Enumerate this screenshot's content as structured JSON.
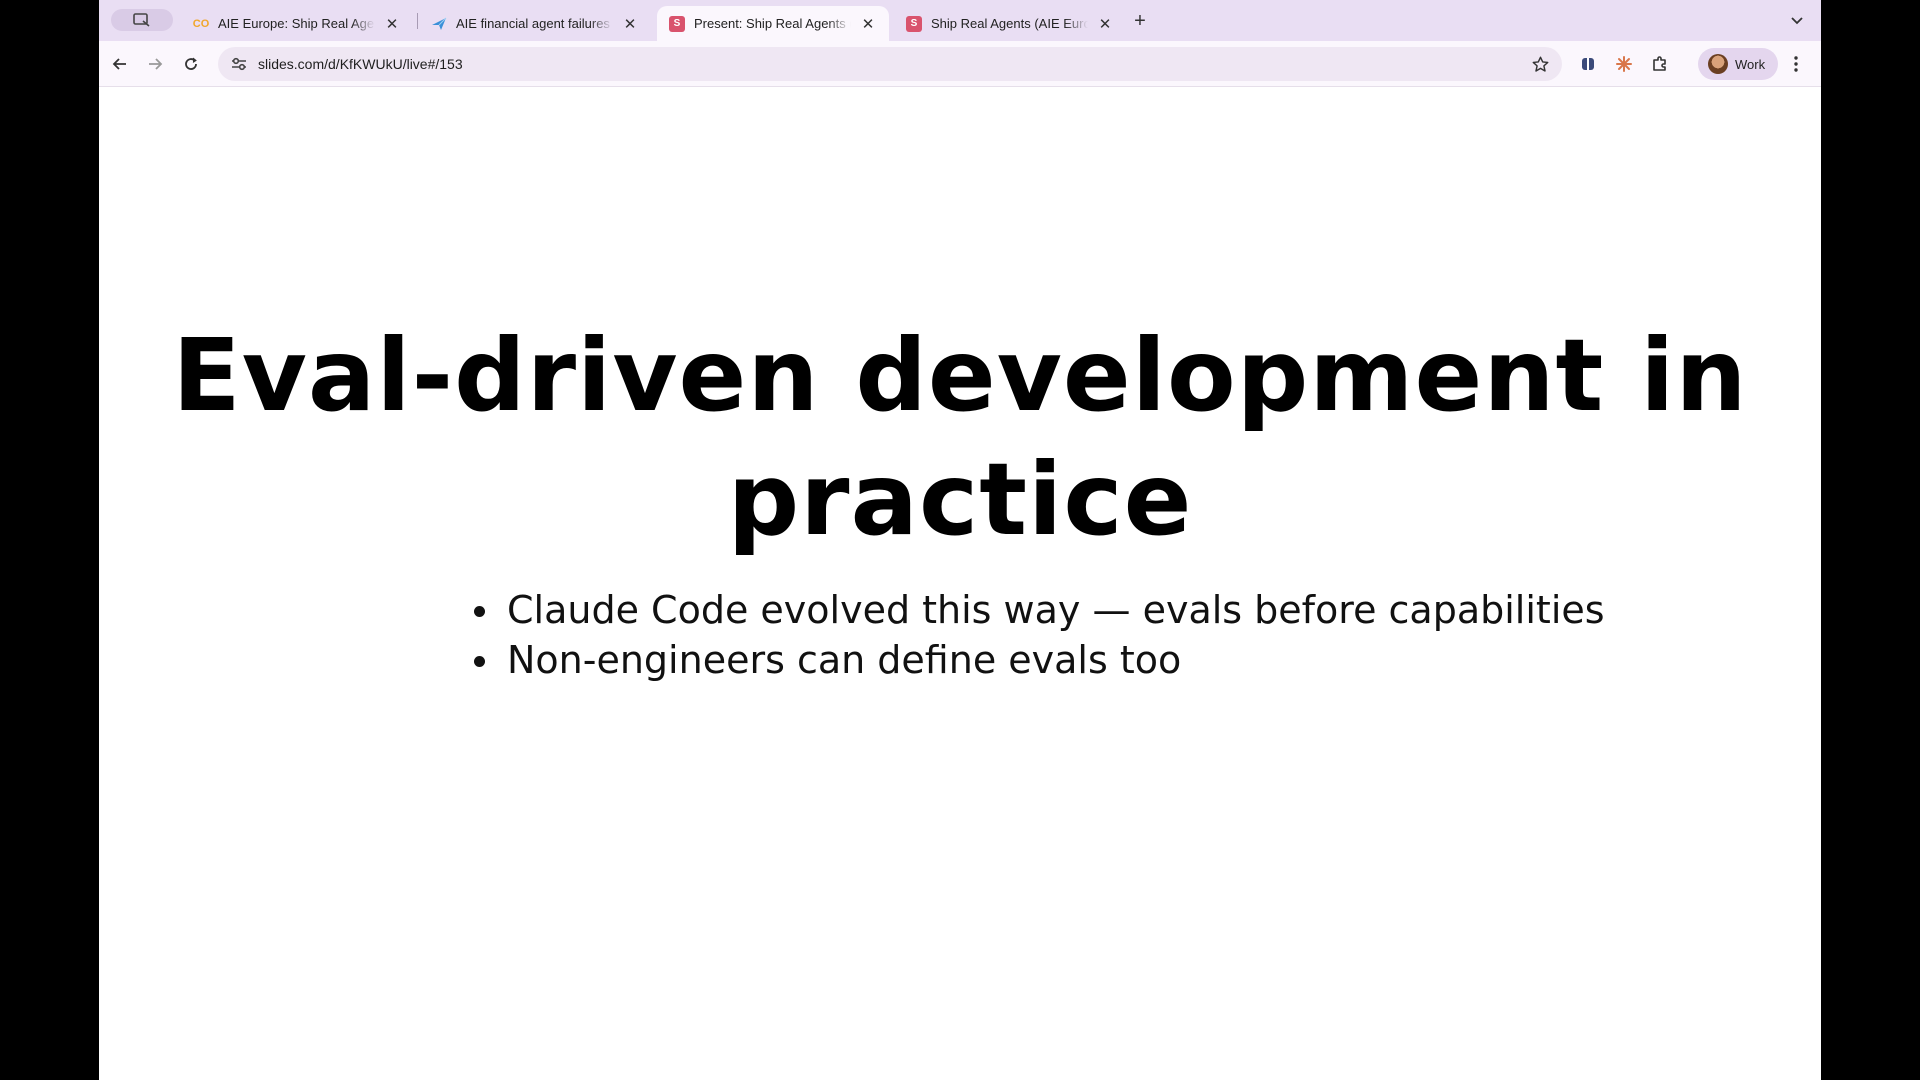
{
  "browser": {
    "tabs": [
      {
        "title": "AIE Europe: Ship Real Agents",
        "favicon": "CO",
        "favicon_color": "#f1a72b",
        "active": false
      },
      {
        "title": "AIE financial agent failures - ",
        "favicon": "plane-logo",
        "favicon_color": "#3a8fd8",
        "active": false
      },
      {
        "title": "Present: Ship Real Agents (AI",
        "favicon": "S",
        "favicon_color": "#d9536d",
        "active": true
      },
      {
        "title": "Ship Real Agents (AIE Europe",
        "favicon": "S",
        "favicon_color": "#d9536d",
        "active": false
      }
    ],
    "url": "slides.com/d/KfKWUkU/live#/153",
    "profile_label": "Work",
    "accent": "#e9def3"
  },
  "slide": {
    "title": "Eval-driven development in practice",
    "bullets": [
      "Claude Code evolved this way — evals before capabilities",
      "Non-engineers can define evals too"
    ]
  }
}
